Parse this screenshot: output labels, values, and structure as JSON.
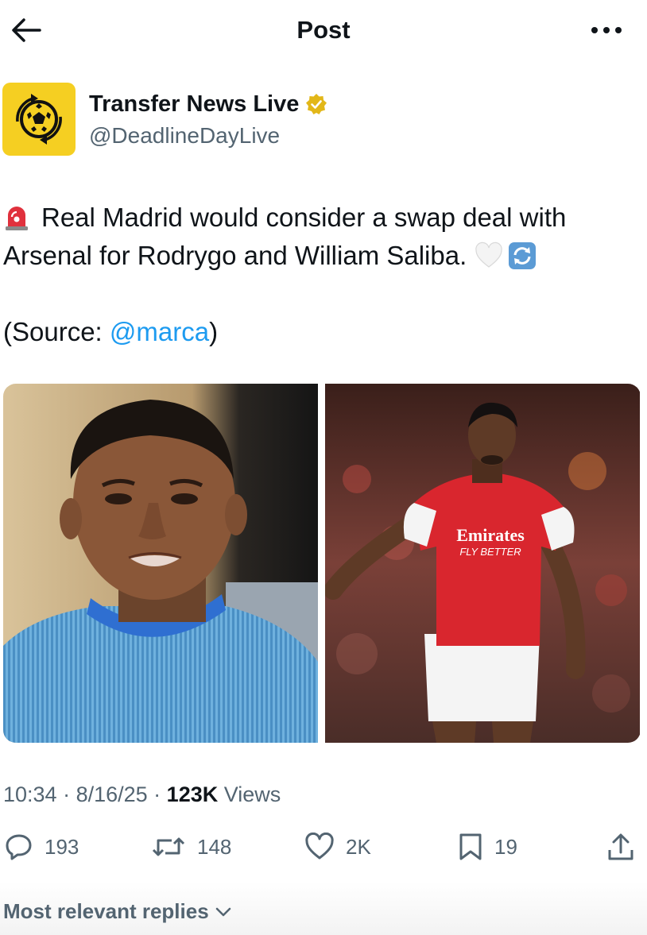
{
  "header": {
    "title": "Post",
    "back_icon": "arrow-left-icon",
    "more_icon": "more-horizontal-icon"
  },
  "author": {
    "name": "Transfer News Live",
    "handle": "@DeadlineDayLive",
    "verified_color": "#e2b719",
    "avatar_color": "#f5cf22"
  },
  "tweet": {
    "line1": "Real Madrid would consider a swap deal with",
    "line2": "Arsenal for Rodrygo and William Saliba.",
    "source_prefix": "(Source: ",
    "source_mention": "@marca",
    "source_suffix": ")",
    "emojis": [
      "siren-emoji",
      "white-heart-emoji",
      "arrows-cycle-emoji"
    ]
  },
  "media": {
    "photos": [
      {
        "name": "rodrygo-photo",
        "shirt_text": ""
      },
      {
        "name": "saliba-photo",
        "shirt_text": "Emirates",
        "shirt_subtext": "FLY BETTER"
      }
    ]
  },
  "meta": {
    "time": "10:34",
    "date": "8/16/25",
    "views_count": "123K",
    "views_label": " Views",
    "separator": " · "
  },
  "actions": {
    "replies": "193",
    "reposts": "148",
    "likes": "2K",
    "bookmarks": "19"
  },
  "replies_sort": {
    "label": "Most relevant replies"
  },
  "colors": {
    "accent": "#1d9bf0",
    "secondary_text": "#536471",
    "arsenal_red": "#d9262e"
  }
}
